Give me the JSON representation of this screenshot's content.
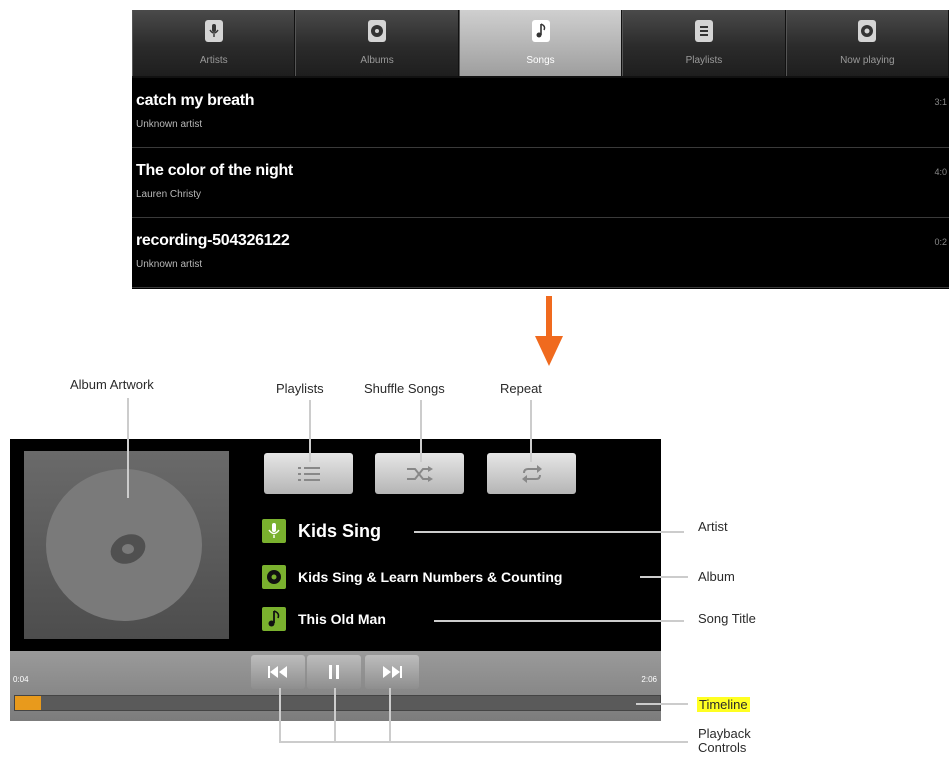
{
  "library": {
    "tabs": [
      {
        "label": "Artists",
        "icon": "microphone-icon",
        "active": false
      },
      {
        "label": "Albums",
        "icon": "disc-icon",
        "active": false
      },
      {
        "label": "Songs",
        "icon": "music-note-icon",
        "active": true
      },
      {
        "label": "Playlists",
        "icon": "list-icon",
        "active": false
      },
      {
        "label": "Now playing",
        "icon": "now-playing-icon",
        "active": false
      }
    ],
    "songs": [
      {
        "title": "catch my breath",
        "artist": "Unknown artist",
        "duration": "3:1"
      },
      {
        "title": "The color of the night",
        "artist": "Lauren Christy",
        "duration": "4:0"
      },
      {
        "title": "recording-504326122",
        "artist": "Unknown artist",
        "duration": "0:2"
      }
    ]
  },
  "callouts": {
    "album_artwork": "Album Artwork",
    "playlists": "Playlists",
    "shuffle": "Shuffle Songs",
    "repeat": "Repeat",
    "artist": "Artist",
    "album": "Album",
    "song_title": "Song Title",
    "timeline": "Timeline",
    "playback_controls": "Playback Controls"
  },
  "player": {
    "artist": "Kids Sing",
    "album": "Kids Sing & Learn Numbers & Counting",
    "song": "This Old Man",
    "elapsed": "0:04",
    "total": "2:06",
    "progress": 0.03
  },
  "colors": {
    "arrow": "#f06a1e",
    "accent_green": "#7ab12e",
    "timeline_fill": "#e89a1c",
    "highlight": "#ffff22"
  }
}
